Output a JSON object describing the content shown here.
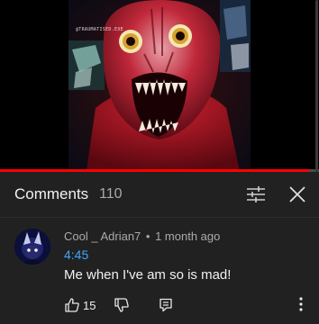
{
  "video": {
    "watermark": "@TRAUMATISED.EXE",
    "progress": 0.97
  },
  "comments_panel": {
    "title": "Comments",
    "count": "110",
    "filter_icon": "sort-filter-icon",
    "close_icon": "close-icon"
  },
  "comment": {
    "author": "Cool _ Adrian7",
    "separator": "•",
    "age": "1 month ago",
    "timestamp_link": "4:45",
    "text": "Me when I've am so is mad!",
    "likes": "15",
    "icons": [
      "thumb-up-icon",
      "thumb-down-icon",
      "reply-icon",
      "more-vertical-icon"
    ]
  },
  "colors": {
    "background": "#212121",
    "link": "#3ea6ff",
    "progress": "#ff0000",
    "secondary_text": "#aaaaaa"
  }
}
